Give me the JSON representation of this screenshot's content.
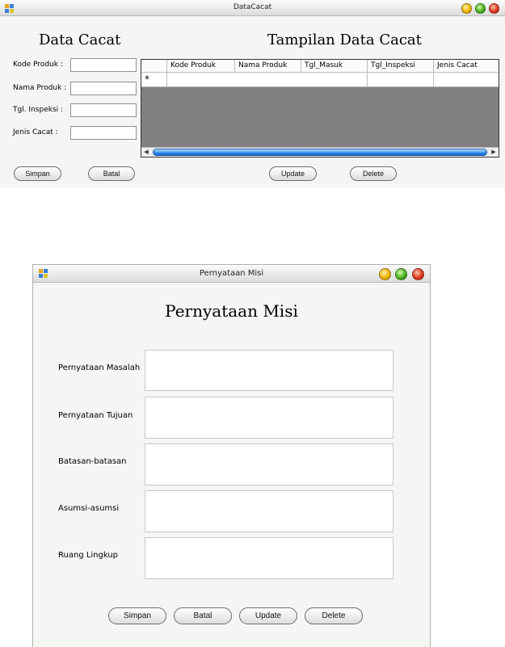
{
  "window1": {
    "title": "DataCacat",
    "form_heading": "Data Cacat",
    "grid_heading": "Tampilan Data Cacat",
    "fields": [
      {
        "label": "Kode Produk :",
        "value": ""
      },
      {
        "label": "Nama Produk :",
        "value": ""
      },
      {
        "label": "Tgl. Inspeksi :",
        "value": ""
      },
      {
        "label": "Jenis Cacat :",
        "value": ""
      }
    ],
    "grid": {
      "columns": [
        "Kode Produk",
        "Nama Produk",
        "Tgl_Masuk",
        "Tgl_Inspeksi",
        "Jenis Cacat"
      ],
      "new_row_marker": "*"
    },
    "buttons": {
      "save": "Simpan",
      "cancel": "Batal",
      "update": "Update",
      "delete": "Delete"
    }
  },
  "window2": {
    "title": "Pernyataan Misi",
    "heading": "Pernyataan Misi",
    "fields": [
      {
        "label": "Pernyataan Masalah",
        "value": ""
      },
      {
        "label": "Pernyataan Tujuan",
        "value": ""
      },
      {
        "label": "Batasan-batasan",
        "value": ""
      },
      {
        "label": "Asumsi-asumsi",
        "value": ""
      },
      {
        "label": "Ruang Lingkup",
        "value": ""
      }
    ],
    "buttons": {
      "save": "Simpan",
      "cancel": "Batal",
      "update": "Update",
      "delete": "Delete"
    }
  }
}
